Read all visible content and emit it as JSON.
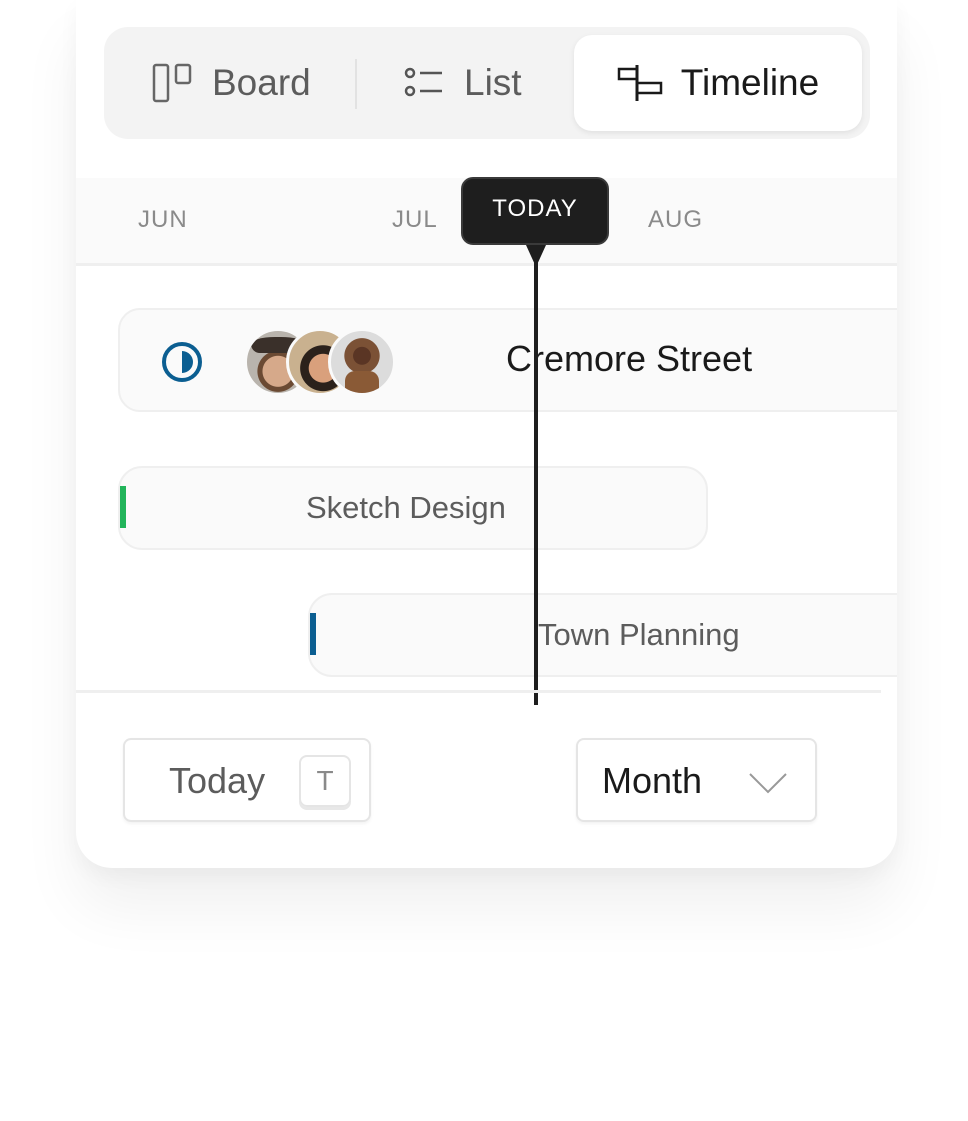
{
  "view_switcher": {
    "items": [
      {
        "label": "Board",
        "icon": "board-icon",
        "active": false
      },
      {
        "label": "List",
        "icon": "list-icon",
        "active": false
      },
      {
        "label": "Timeline",
        "icon": "timeline-icon",
        "active": true
      }
    ]
  },
  "timeline": {
    "months": [
      "JUN",
      "JUL",
      "AUG"
    ],
    "today_marker": "TODAY",
    "project": {
      "title": "Cremore Street",
      "status_icon": "half-circle-status-icon",
      "status_color": "#0b5e91",
      "avatars": [
        "avatar-man-hat",
        "avatar-woman-smiling",
        "avatar-woman-curly-hair"
      ]
    },
    "tasks": [
      {
        "label": "Sketch Design",
        "accent_color": "#22b45a"
      },
      {
        "label": "Town Planning",
        "accent_color": "#0b5e91"
      }
    ]
  },
  "footer": {
    "today_button": "Today",
    "today_shortcut": "T",
    "zoom_select": "Month"
  }
}
